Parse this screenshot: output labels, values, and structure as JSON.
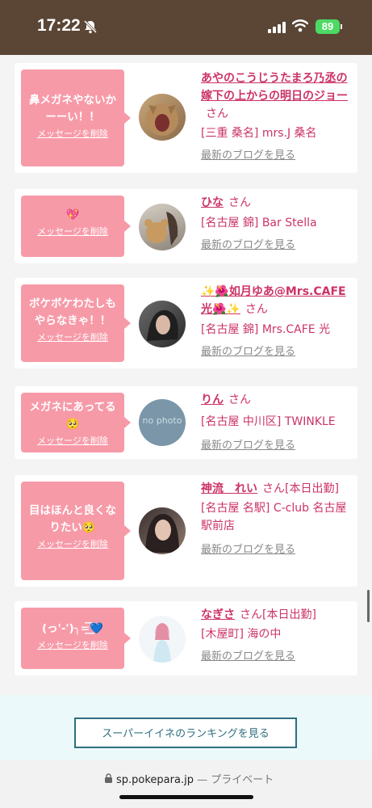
{
  "status_bar": {
    "time": "17:22",
    "battery": "89",
    "icons": [
      "bell-slash-icon",
      "signal-icon",
      "wifi-icon",
      "battery-icon"
    ]
  },
  "cards": [
    {
      "message": "鼻メガネやないかーーい！！",
      "delete_label": "メッセージを削除",
      "name": "あやのこうじうたまろ乃丞の嫁下の上からの明日のジョー",
      "honorific": "さん",
      "status": "",
      "shop": "[三重 桑名] mrs.J 桑名",
      "blog_label": "最新のブログを見る"
    },
    {
      "message": "💖",
      "delete_label": "メッセージを削除",
      "name": "ひな",
      "honorific": "さん",
      "status": "",
      "shop": "[名古屋 錦] Bar Stella",
      "blog_label": "最新のブログを見る"
    },
    {
      "message": "ボケボケわたしもやらなきゃ！！",
      "delete_label": "メッセージを削除",
      "name": "✨🌺如月ゆあ@Mrs.CAFE光🌺✨",
      "honorific": "さん",
      "status": "",
      "shop": "[名古屋 錦] Mrs.CAFE 光",
      "blog_label": "最新のブログを見る"
    },
    {
      "message": "メガネにあってる🥺",
      "delete_label": "メッセージを削除",
      "name": "りん",
      "honorific": "さん",
      "status": "",
      "shop": "[名古屋 中川区] TWINKLE",
      "blog_label": "最新のブログを見る",
      "avatar_text": "no photo"
    },
    {
      "message": "目はほんと良くなりたい🥺",
      "delete_label": "メッセージを削除",
      "name": "神流　れい",
      "honorific": "さん",
      "status": "[本日出勤]",
      "shop": "[名古屋 名駅] C-club 名古屋駅前店",
      "blog_label": "最新のブログを見る"
    },
    {
      "message": "(っ'-')╮=͟͟͞͞💙",
      "delete_label": "メッセージを削除",
      "name": "なぎさ",
      "honorific": "さん",
      "status": "[本日出勤]",
      "shop": "[木屋町] 海の中",
      "blog_label": "最新のブログを見る"
    }
  ],
  "ranking_button": "スーパーイイネのランキングを見る",
  "url_bar": {
    "url": "sp.pokepara.jp",
    "suffix": "— プライベート"
  },
  "colors": {
    "status_bar_bg": "#5b4636",
    "bubble": "#f79aa8",
    "name": "#cc3366",
    "button_border": "#2f6f7f"
  }
}
